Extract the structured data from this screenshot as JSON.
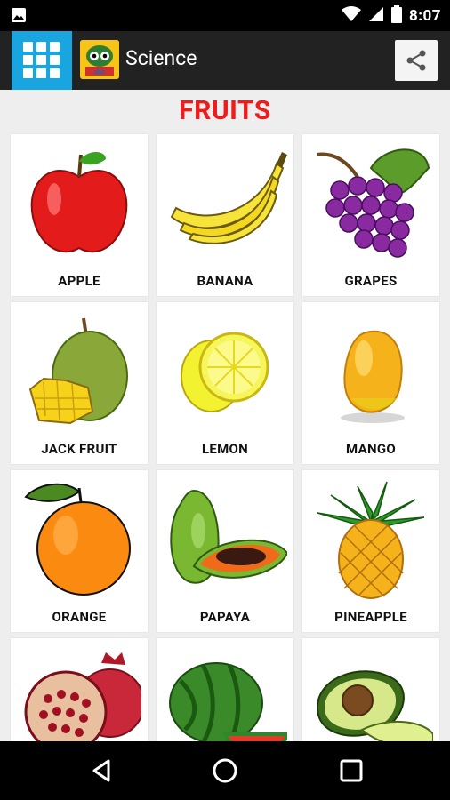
{
  "status_bar": {
    "time": "8:07"
  },
  "app_bar": {
    "title": "Science"
  },
  "section": {
    "title": "FRUITS"
  },
  "items": [
    {
      "label": "APPLE",
      "icon": "apple-icon"
    },
    {
      "label": "BANANA",
      "icon": "banana-icon"
    },
    {
      "label": "GRAPES",
      "icon": "grapes-icon"
    },
    {
      "label": "JACK FRUIT",
      "icon": "jackfruit-icon"
    },
    {
      "label": "LEMON",
      "icon": "lemon-icon"
    },
    {
      "label": "MANGO",
      "icon": "mango-icon"
    },
    {
      "label": "ORANGE",
      "icon": "orange-icon"
    },
    {
      "label": "PAPAYA",
      "icon": "papaya-icon"
    },
    {
      "label": "PINEAPPLE",
      "icon": "pineapple-icon"
    },
    {
      "label": "",
      "icon": "pomegranate-icon"
    },
    {
      "label": "",
      "icon": "watermelon-icon"
    },
    {
      "label": "",
      "icon": "avocado-icon"
    }
  ]
}
